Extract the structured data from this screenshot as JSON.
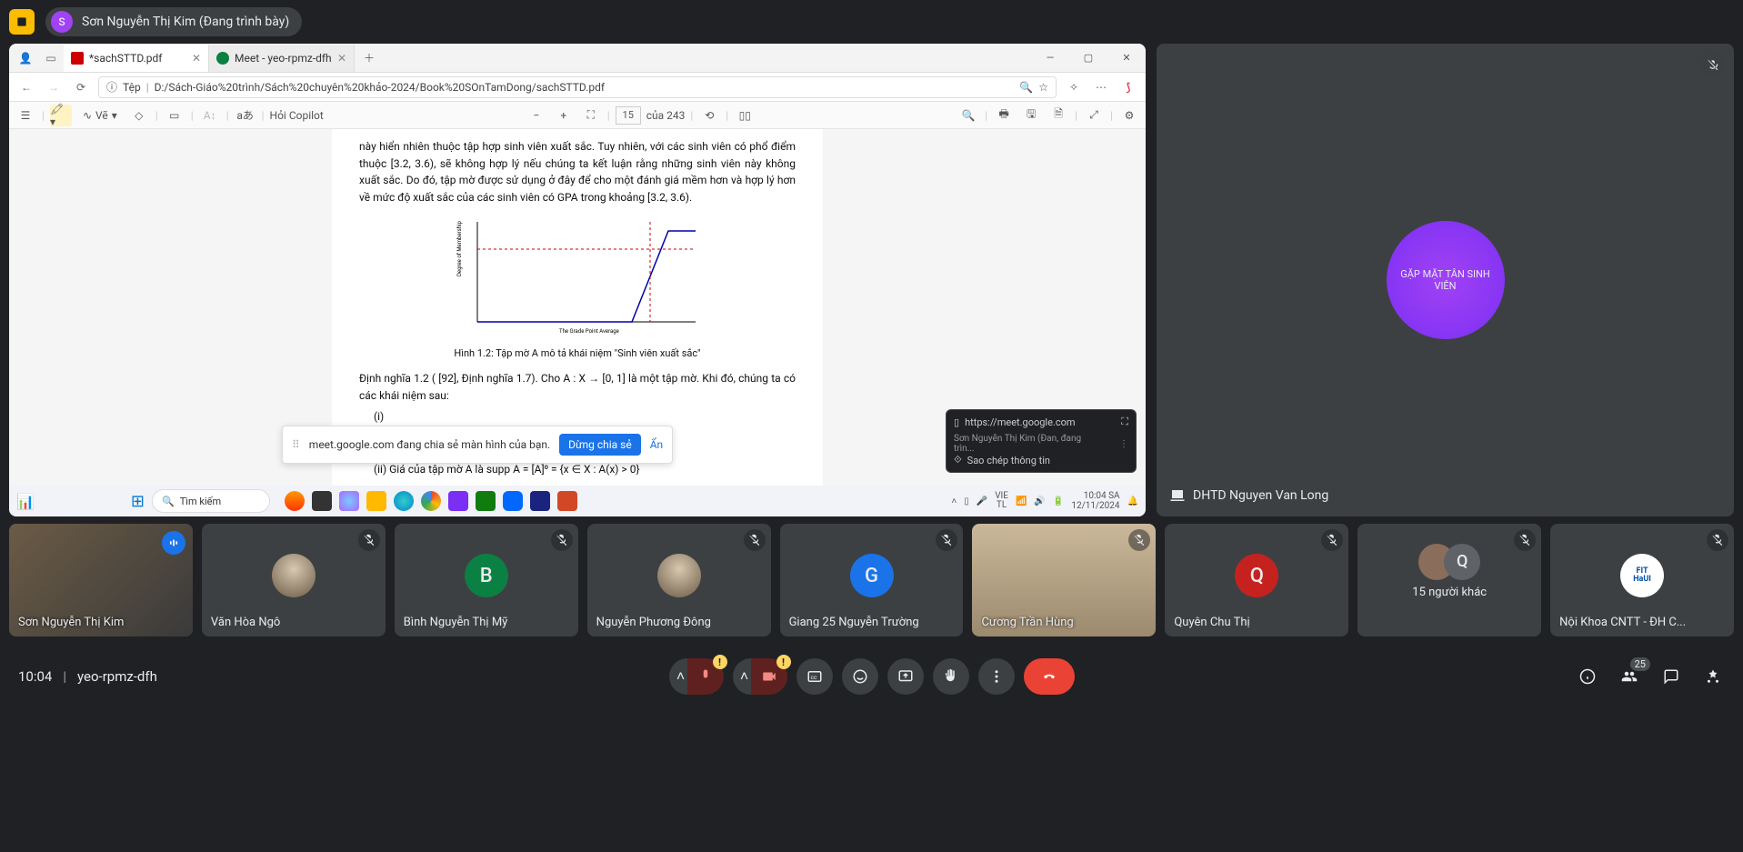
{
  "header": {
    "presenter_initial": "S",
    "presenter_label": "Sơn Nguyễn Thị Kim (Đang trình bày)"
  },
  "share": {
    "tabs": [
      {
        "title": "*sachSTTD.pdf"
      },
      {
        "title": "Meet - yeo-rpmz-dfh"
      }
    ],
    "address": "D:/Sách-Giáo%20trình/Sách%20chuyên%20khảo-2024/Book%20SOnTamDong/sachSTTD.pdf",
    "addr_prefix": "Tệp",
    "toolbar": {
      "draw_label": "Vẽ",
      "copilot": "Hỏi Copilot",
      "page": "15",
      "total_pages": "của 243"
    },
    "document": {
      "paragraph": "này hiển nhiên thuộc tập hợp sinh viên xuất sắc. Tuy nhiên, với các sinh viên có phổ điểm thuộc [3.2, 3.6), sẽ không hợp lý nếu chúng ta kết luận rằng những sinh viên này không xuất sắc. Do đó, tập mờ được sử dụng ở đây để cho một đánh giá mềm hơn và hợp lý hơn về mức độ xuất sắc của các sinh viên có GPA trong khoảng [3.2, 3.6).",
      "yaxis": "Degree of Membership",
      "xaxis": "The Grade Point Average",
      "figure_caption": "Hình 1.2: Tập mờ A mô tả khái niệm \"Sinh viên xuất sắc\"",
      "definition": "Định nghĩa 1.2 ( [92], Định nghĩa 1.7). Cho A : X → [0, 1] là một tập mờ. Khi đó, chúng ta có các khái niệm sau:",
      "item_i": "(i) ",
      "item_ii": "(ii) Giá của tập mờ A là supp A = [A]⁰ = {x ∈ X : A(x) > 0}"
    },
    "notice": {
      "text": "meet.google.com đang chia sẻ màn hình của bạn.",
      "stop": "Dừng chia sẻ",
      "hide": "Ẩn"
    },
    "pip": {
      "url": "https://meet.google.com",
      "line1": "Sơn Nguyễn Thị Kim (Đan, đang trìn...",
      "line2": "Sao chép thông tin"
    },
    "taskbar": {
      "search": "Tìm kiếm",
      "lang": "VIE\nTL",
      "time": "10:04 SA",
      "date": "12/11/2024"
    }
  },
  "pinned": {
    "avatar_text": "GẶP MẶT TÂN SINH VIÊN",
    "name": "DHTD Nguyen Van Long"
  },
  "participants": [
    {
      "name": "Sơn Nguyễn Thị Kim",
      "type": "cam",
      "speaking": true
    },
    {
      "name": "Văn Hòa Ngô",
      "type": "avatar-img"
    },
    {
      "name": "Bình Nguyễn Thị Mỹ",
      "type": "letter",
      "letter": "B",
      "color": "#0b8043"
    },
    {
      "name": "Nguyễn Phương Đông",
      "type": "avatar-img"
    },
    {
      "name": "Giang 25 Nguyễn Trường",
      "type": "letter",
      "letter": "G",
      "color": "#1a73e8"
    },
    {
      "name": "Cương Trần Hùng",
      "type": "cam-room"
    },
    {
      "name": "Quyên Chu Thị",
      "type": "letter",
      "letter": "Q",
      "color": "#c5221f"
    },
    {
      "name": "others",
      "type": "others",
      "letter": "Q",
      "others_count": "15 người khác"
    },
    {
      "name": "Nội Khoa CNTT - ĐH C...",
      "type": "logo"
    }
  ],
  "footer": {
    "time": "10:04",
    "code": "yeo-rpmz-dfh",
    "people_badge": "25"
  }
}
